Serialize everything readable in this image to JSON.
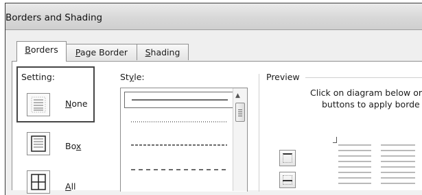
{
  "window": {
    "title": "Borders and Shading"
  },
  "tabs": [
    {
      "label_pre": "",
      "label_key": "B",
      "label_post": "orders",
      "active": true
    },
    {
      "label_pre": "",
      "label_key": "P",
      "label_post": "age Border",
      "active": false
    },
    {
      "label_pre": "",
      "label_key": "S",
      "label_post": "hading",
      "active": false
    }
  ],
  "setting": {
    "label": "Setting:",
    "options": [
      {
        "label_pre": "",
        "label_key": "N",
        "label_post": "one",
        "icon": "border-none-icon",
        "selected": true
      },
      {
        "label_pre": "Bo",
        "label_key": "x",
        "label_post": "",
        "icon": "border-box-icon",
        "selected": false
      },
      {
        "label_pre": "",
        "label_key": "A",
        "label_post": "ll",
        "icon": "border-all-icon",
        "selected": false
      }
    ]
  },
  "style": {
    "label_pre": "St",
    "label_key": "y",
    "label_post": "le:",
    "items": [
      {
        "pattern": "solid",
        "selected": true
      },
      {
        "pattern": "dotted",
        "selected": false
      },
      {
        "pattern": "short-dash",
        "selected": false
      },
      {
        "pattern": "long-dash",
        "selected": false
      }
    ]
  },
  "preview": {
    "label": "Preview",
    "help_line1": "Click on diagram below or",
    "help_line2": "buttons to apply borde",
    "buttons": [
      "top-border-icon",
      "middle-border-icon"
    ]
  },
  "colors": {
    "dialog_bg": "#efefef",
    "panel_bg": "#ffffff",
    "border": "#8f8f8f",
    "selected_outline": "#454545"
  }
}
